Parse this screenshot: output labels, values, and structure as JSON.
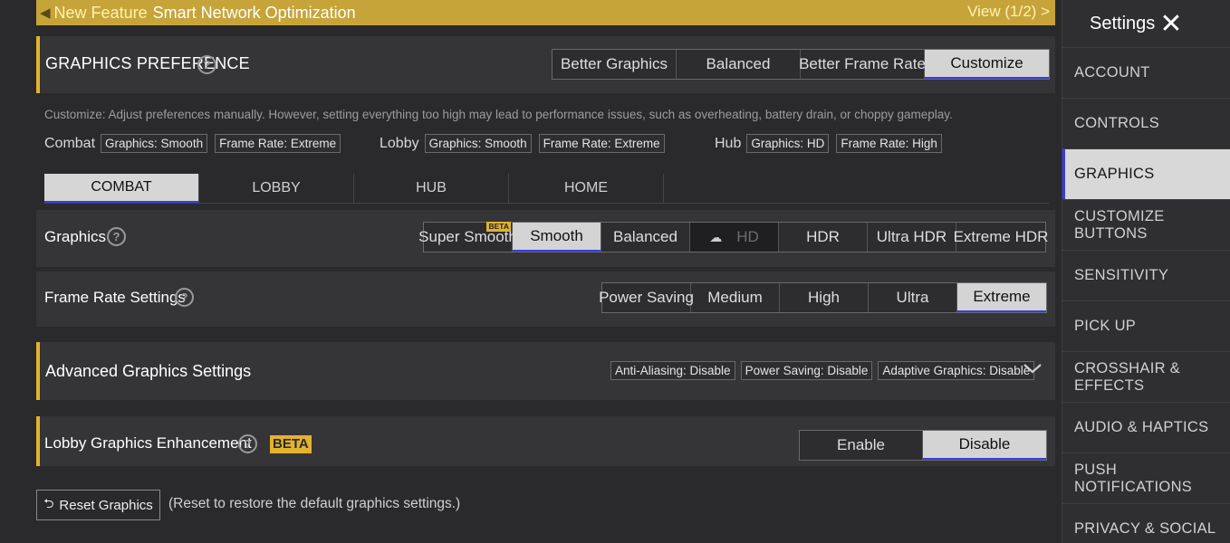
{
  "banner": {
    "speaker_icon": "speaker-icon",
    "tag": "New Feature",
    "title": "Smart Network Optimization",
    "view": "View (1/2) >"
  },
  "graphics_preference": {
    "label": "GRAPHICS PREFERENCE",
    "help": "?",
    "options": [
      "Better Graphics",
      "Balanced",
      "Better Frame Rate",
      "Customize"
    ],
    "selected": "Customize"
  },
  "description": "Customize: Adjust preferences manually. However, setting everything too high may lead to performance issues, such as overheating, battery drain, or choppy gameplay.",
  "summary": {
    "combat": {
      "name": "Combat",
      "graphics": "Graphics: Smooth",
      "frame_rate": "Frame Rate: Extreme"
    },
    "lobby": {
      "name": "Lobby",
      "graphics": "Graphics: Smooth",
      "frame_rate": "Frame Rate: Extreme"
    },
    "hub": {
      "name": "Hub",
      "graphics": "Graphics: HD",
      "frame_rate": "Frame Rate: High"
    }
  },
  "tabs": [
    "COMBAT",
    "LOBBY",
    "HUB",
    "HOME"
  ],
  "graphics": {
    "label": "Graphics",
    "help": "?",
    "beta": "BETA",
    "options": [
      "Super Smooth",
      "Smooth",
      "Balanced",
      "HD",
      "HDR",
      "Ultra HDR",
      "Extreme HDR"
    ],
    "selected": "Smooth",
    "hd_icon": "cloud-download-icon"
  },
  "frame_rate": {
    "label": "Frame Rate Settings",
    "help": "?",
    "options": [
      "Power Saving",
      "Medium",
      "High",
      "Ultra",
      "Extreme"
    ],
    "selected": "Extreme"
  },
  "advanced": {
    "label": "Advanced Graphics Settings",
    "chips": [
      "Anti-Aliasing: Disable",
      "Power Saving: Disable",
      "Adaptive Graphics: Disable"
    ],
    "chevron": "⌄"
  },
  "lobby_enhancement": {
    "label": "Lobby Graphics Enhancement",
    "help": "?",
    "beta": "BETA",
    "options": [
      "Enable",
      "Disable"
    ],
    "selected": "Disable"
  },
  "reset": {
    "button": "Reset Graphics",
    "icon": "undo-icon",
    "note": "(Reset to restore the default graphics settings.)"
  },
  "sidebar": {
    "title": "Settings",
    "close": "✕",
    "items": [
      "ACCOUNT",
      "CONTROLS",
      "GRAPHICS",
      "CUSTOMIZE BUTTONS",
      "SENSITIVITY",
      "PICK UP",
      "CROSSHAIR & EFFECTS",
      "AUDIO & HAPTICS",
      "PUSH NOTIFICATIONS",
      "PRIVACY & SOCIAL"
    ],
    "selected": "GRAPHICS"
  },
  "colors": {
    "accent": "#e3b32e",
    "banner": "#c7a43a",
    "selected_bg": "#d4d4d4",
    "selected_underline": "#3a3ae0"
  }
}
